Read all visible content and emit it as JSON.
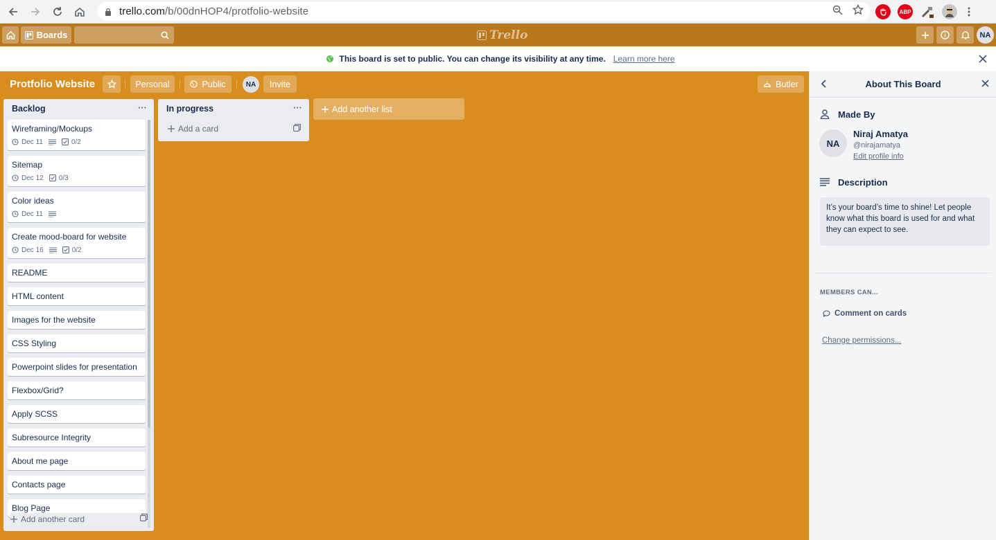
{
  "browser": {
    "url_host": "trello.com",
    "url_path": "/b/00dnHOP4/protfolio-website",
    "ext_abp": "ABP"
  },
  "header": {
    "boards_label": "Boards",
    "logo_text": "Trello",
    "avatar_initials": "NA"
  },
  "notice": {
    "text": "This board is set to public. You can change its visibility at any time.",
    "link": "Learn more here"
  },
  "board": {
    "title": "Protfolio Website",
    "team_label": "Personal",
    "visibility_label": "Public",
    "member_initials": "NA",
    "invite_label": "Invite",
    "butler_label": "Butler"
  },
  "lists": [
    {
      "name": "Backlog",
      "menu": "···",
      "cards": [
        {
          "title": "Wireframing/Mockups",
          "date": "Dec 11",
          "description": true,
          "checklist": "0/2"
        },
        {
          "title": "Sitemap",
          "date": "Dec 12",
          "description": false,
          "checklist": "0/3"
        },
        {
          "title": "Color ideas",
          "date": "Dec 11",
          "description": true,
          "checklist": ""
        },
        {
          "title": "Create mood-board for website",
          "date": "Dec 16",
          "description": true,
          "checklist": "0/2"
        },
        {
          "title": "README"
        },
        {
          "title": "HTML content"
        },
        {
          "title": "Images for the website"
        },
        {
          "title": "CSS Styling"
        },
        {
          "title": "Powerpoint slides for presentation"
        },
        {
          "title": "Flexbox/Grid?"
        },
        {
          "title": "Apply SCSS"
        },
        {
          "title": "Subresource Integrity"
        },
        {
          "title": "About me page"
        },
        {
          "title": "Contacts page"
        },
        {
          "title": "Blog Page"
        }
      ],
      "add_card_label": "Add another card"
    },
    {
      "name": "In progress",
      "menu": "···",
      "cards": [],
      "add_card_label": "Add a card"
    }
  ],
  "add_list_label": "Add another list",
  "sidebar": {
    "title": "About This Board",
    "made_by_label": "Made By",
    "owner_initials": "NA",
    "owner_name": "Niraj Amatya",
    "owner_handle": "@nirajamatya",
    "edit_profile": "Edit profile info",
    "description_label": "Description",
    "description_text": "It’s your board’s time to shine! Let people know what this board is used for and what they can expect to see.",
    "members_can_label": "MEMBERS CAN...",
    "comment_label": "Comment on cards",
    "change_permissions": "Change permissions..."
  },
  "colors": {
    "board_bg": "#d98d1e",
    "header_bg": "#b9781b",
    "list_bg": "#ebecf0",
    "sidebar_bg": "#f4f5f7",
    "public_icon": "#61bd4f",
    "abp_red": "#e2001a"
  }
}
